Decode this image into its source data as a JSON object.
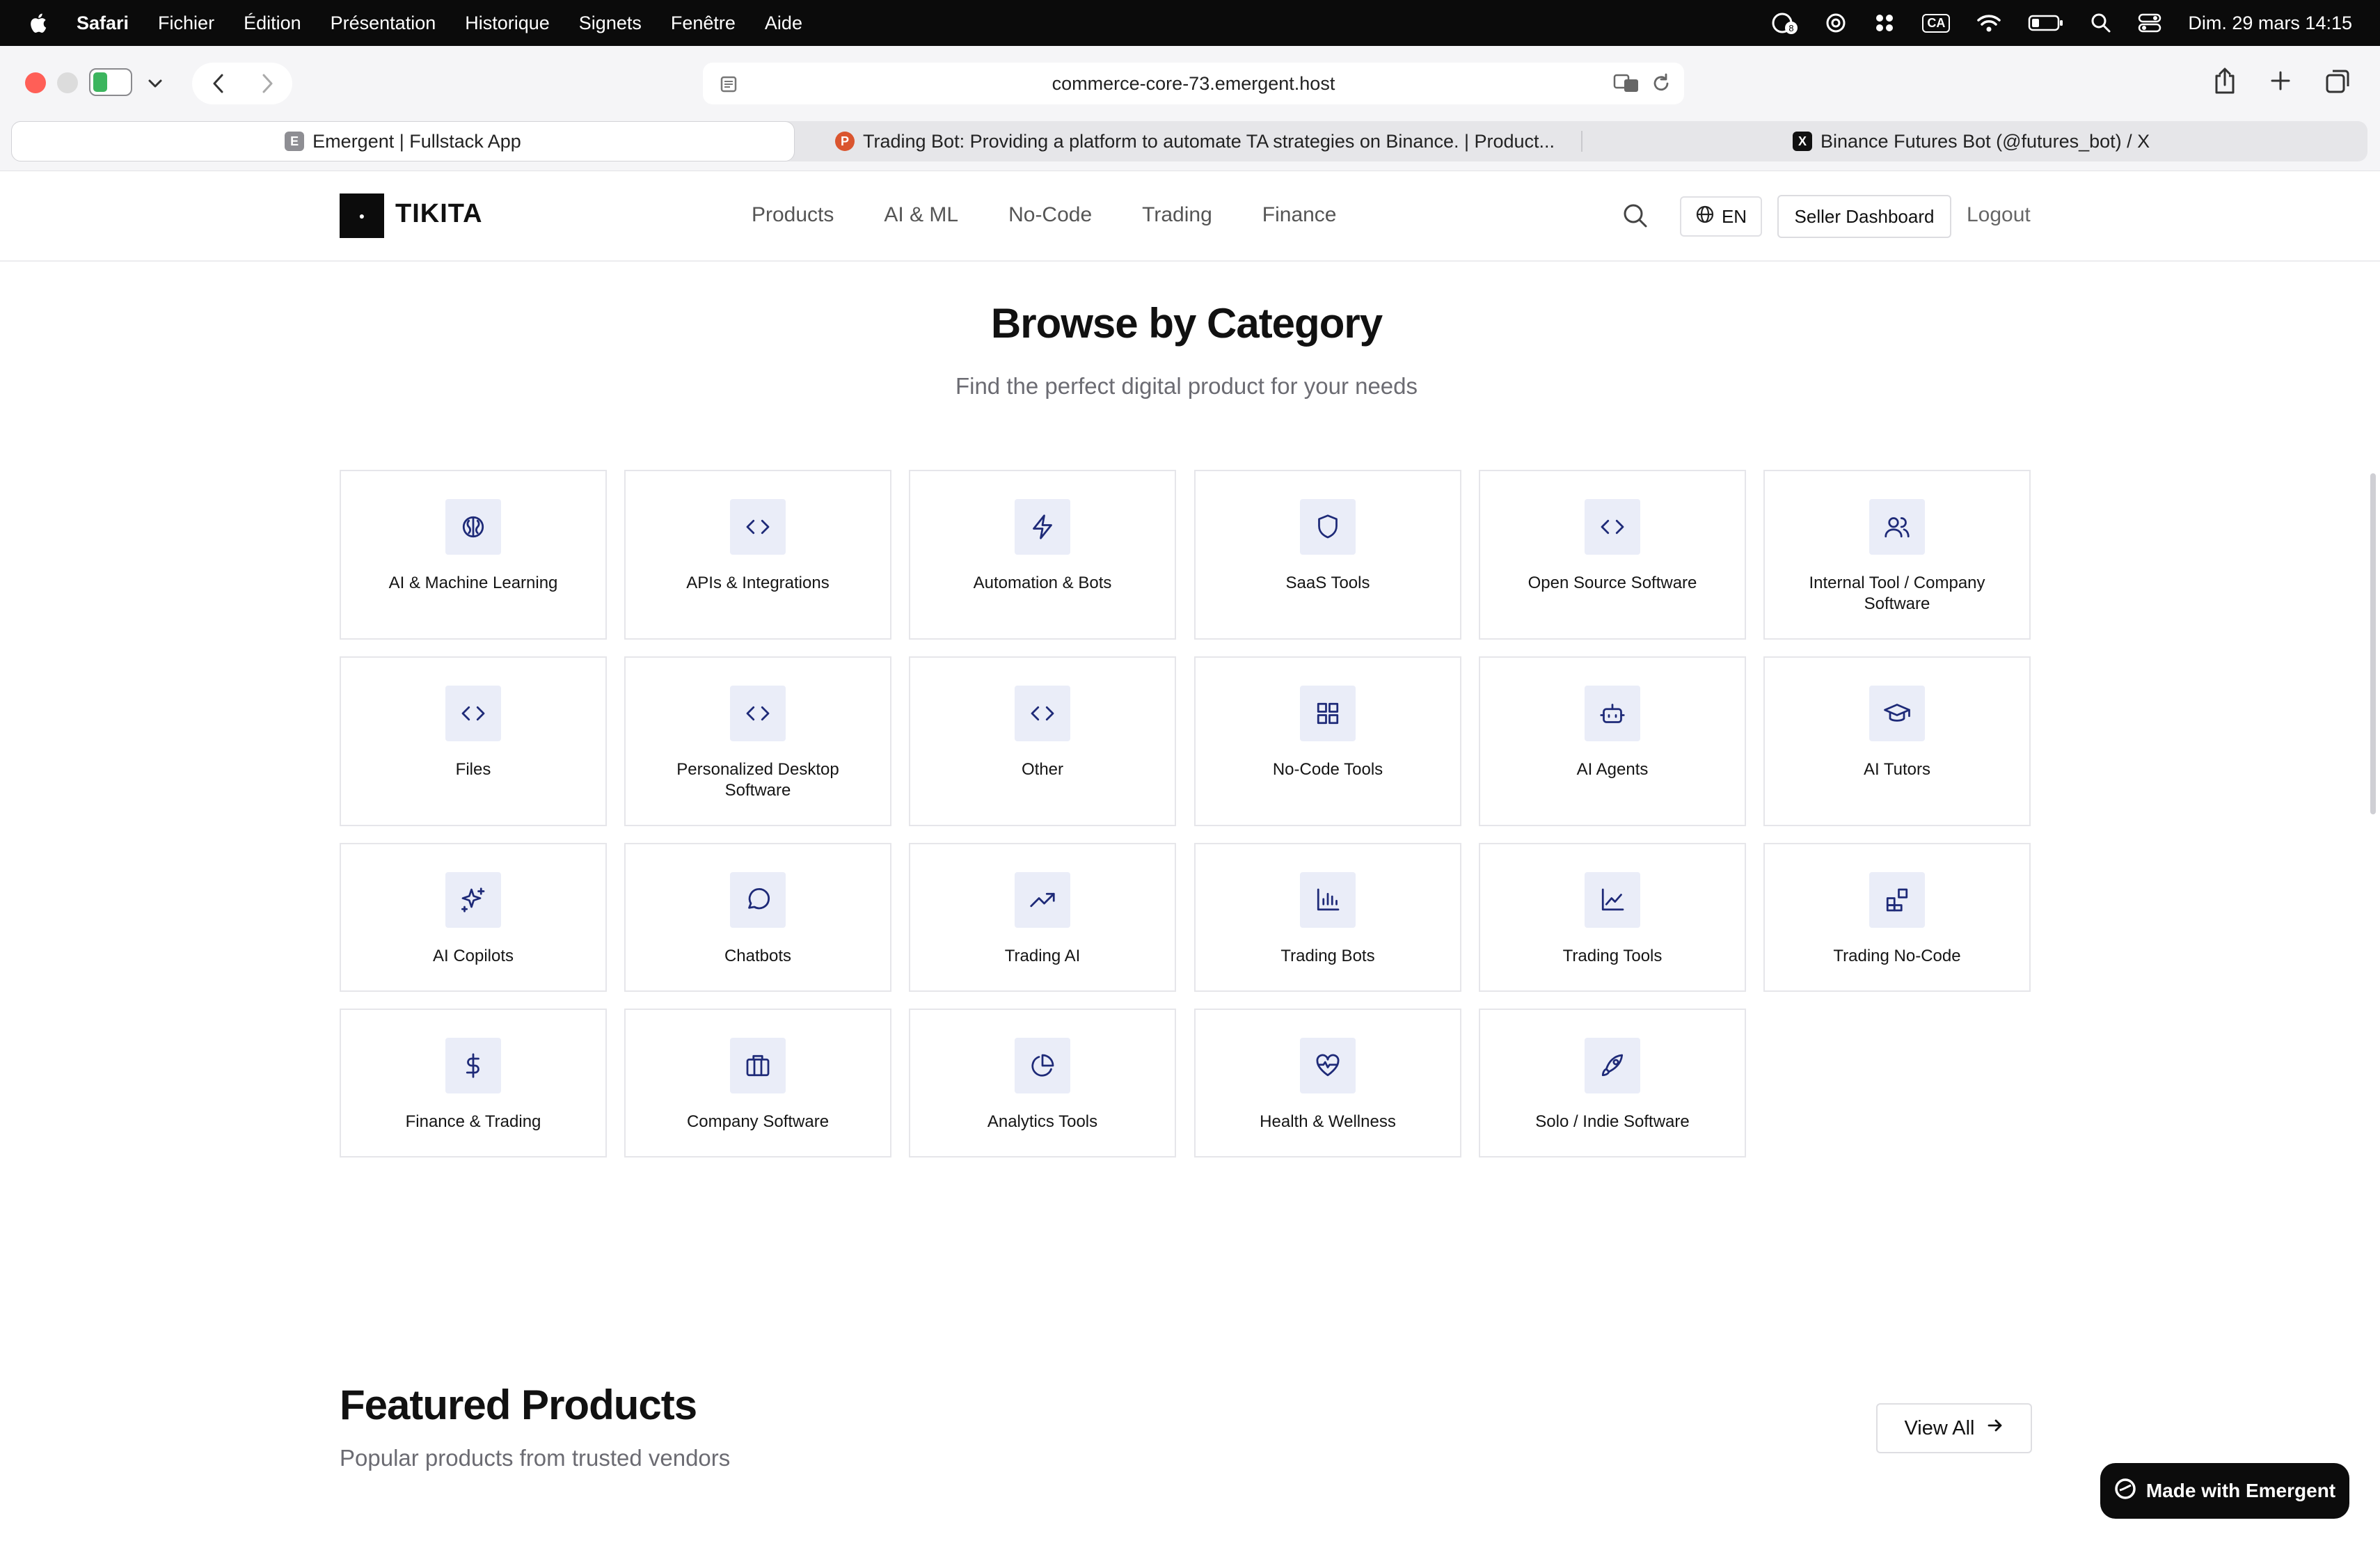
{
  "menubar": {
    "app_name": "Safari",
    "items": [
      "Fichier",
      "Édition",
      "Présentation",
      "Historique",
      "Signets",
      "Fenêtre",
      "Aide"
    ],
    "keyboard_badge": "CA",
    "clock": "Dim. 29 mars  14:15",
    "status_icons": [
      "notification-count-icon",
      "chatgpt-icon",
      "app-grid-icon",
      "keyboard-layout-icon",
      "wifi-icon",
      "battery-icon",
      "spotlight-icon",
      "control-center-icon"
    ]
  },
  "browser": {
    "url": "commerce-core-73.emergent.host",
    "tabs": [
      {
        "title": "Emergent | Fullstack App",
        "favicon_letter": "E",
        "favicon_color": "#8e8e93",
        "active": true
      },
      {
        "title": "Trading Bot: Providing a platform to automate TA strategies on Binance. | Product...",
        "favicon_letter": "P",
        "favicon_color": "#da552f",
        "active": false
      },
      {
        "title": "Binance Futures Bot (@futures_bot) / X",
        "favicon_letter": "X",
        "favicon_color": "#111111",
        "active": false
      }
    ]
  },
  "site": {
    "logo_mark": "●",
    "brand": "TIKITA",
    "nav": [
      "Products",
      "AI & ML",
      "No-Code",
      "Trading",
      "Finance"
    ],
    "language": "EN",
    "seller_dashboard": "Seller Dashboard",
    "logout": "Logout"
  },
  "categories_section": {
    "title": "Browse by Category",
    "subtitle": "Find the perfect digital product for your needs",
    "items": [
      {
        "label": "AI & Machine Learning",
        "icon": "brain-icon"
      },
      {
        "label": "APIs & Integrations",
        "icon": "code-icon"
      },
      {
        "label": "Automation & Bots",
        "icon": "zap-icon"
      },
      {
        "label": "SaaS Tools",
        "icon": "shield-icon"
      },
      {
        "label": "Open Source Software",
        "icon": "code-icon"
      },
      {
        "label": "Internal Tool / Company Software",
        "icon": "users-icon"
      },
      {
        "label": "Files",
        "icon": "code-icon"
      },
      {
        "label": "Personalized Desktop Software",
        "icon": "code-icon"
      },
      {
        "label": "Other",
        "icon": "code-icon"
      },
      {
        "label": "No-Code Tools",
        "icon": "grid-icon"
      },
      {
        "label": "AI Agents",
        "icon": "bot-icon"
      },
      {
        "label": "AI Tutors",
        "icon": "graduation-cap-icon"
      },
      {
        "label": "AI Copilots",
        "icon": "sparkles-icon"
      },
      {
        "label": "Chatbots",
        "icon": "message-circle-icon"
      },
      {
        "label": "Trading AI",
        "icon": "trending-up-icon"
      },
      {
        "label": "Trading Bots",
        "icon": "bar-chart-icon"
      },
      {
        "label": "Trading Tools",
        "icon": "line-chart-icon"
      },
      {
        "label": "Trading No-Code",
        "icon": "blocks-icon"
      },
      {
        "label": "Finance & Trading",
        "icon": "dollar-icon"
      },
      {
        "label": "Company Software",
        "icon": "briefcase-icon"
      },
      {
        "label": "Analytics Tools",
        "icon": "pie-chart-icon"
      },
      {
        "label": "Health & Wellness",
        "icon": "heart-pulse-icon"
      },
      {
        "label": "Solo / Indie Software",
        "icon": "rocket-icon"
      }
    ]
  },
  "featured": {
    "title": "Featured Products",
    "subtitle": "Popular products from trusted vendors",
    "view_all": "View All"
  },
  "badge": {
    "label": "Made with Emergent"
  },
  "colors": {
    "accent_icon": "#1e2a78",
    "icon_bg": "#eaedf8",
    "card_border": "#e6e6ea"
  }
}
